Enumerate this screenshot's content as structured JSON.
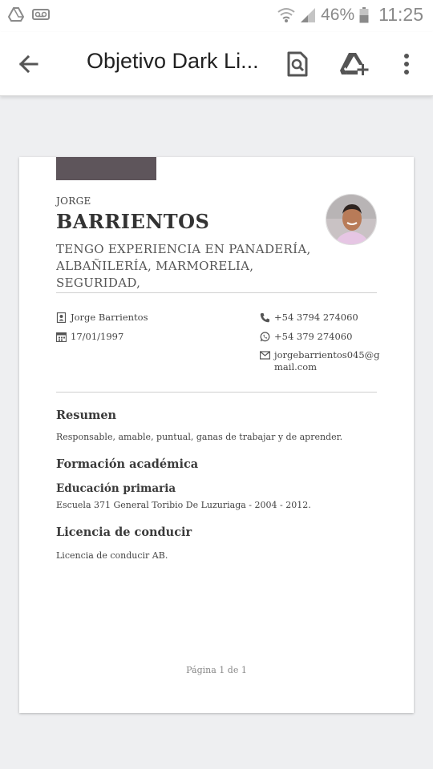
{
  "status_bar": {
    "battery_percent": "46%",
    "time": "11:25",
    "icons": [
      "drive-icon",
      "voicemail-icon",
      "wifi-icon",
      "signal-icon",
      "battery-icon"
    ]
  },
  "app_bar": {
    "title": "Objetivo Dark Li...",
    "icons": [
      "back-arrow-icon",
      "find-in-page-icon",
      "add-to-drive-icon",
      "more-vert-icon"
    ]
  },
  "resume": {
    "first_name": "JORGE",
    "last_name": "BARRIENTOS",
    "headline_line1": "TENGO EXPERIENCIA EN PANADERÍA,",
    "headline_line2": "ALBAÑILERÍA, MARMORELIA, SEGURIDAD,",
    "accent_color": "#5e555b",
    "contact": {
      "name": "Jorge Barrientos",
      "birthdate": "17/01/1997",
      "phone": "+54 3794 274060",
      "whatsapp": "+54 379 274060",
      "email_line1": "jorgebarrientos045@g",
      "email_line2": "mail.com"
    },
    "summary": {
      "title": "Resumen",
      "text": "Responsable, amable, puntual, ganas de trabajar y de aprender."
    },
    "education": {
      "title": "Formación académica",
      "subtitle": "Educación primaria",
      "text": "Escuela 371 General Toribio De Luzuriaga  - 2004 - 2012."
    },
    "license": {
      "title": "Licencia de conducir",
      "text": "Licencia de conducir AB."
    },
    "page_number": "Página 1 de 1"
  }
}
